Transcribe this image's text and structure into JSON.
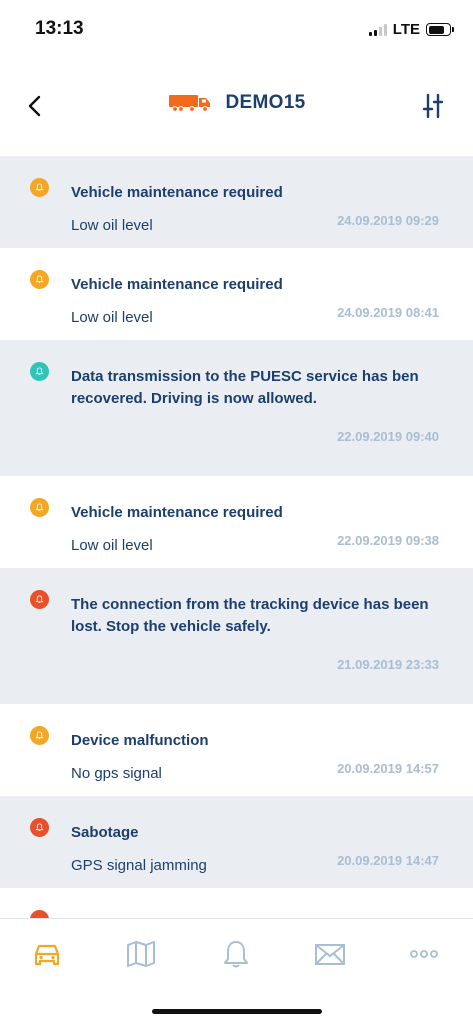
{
  "status": {
    "time": "13:13",
    "network": "LTE"
  },
  "header": {
    "title": "DEMO15"
  },
  "colors": {
    "accent_orange": "#f26b1d",
    "warning": "#f5a623",
    "info": "#2ec4b6",
    "alert": "#e8502a",
    "title_blue": "#1d3f6e",
    "date_gray": "#a9bdd3",
    "tab_inactive": "#a9bdd3"
  },
  "notifications": [
    {
      "severity": "warning",
      "icon": "bell-icon",
      "title": "Vehicle maintenance required",
      "subtitle": "Low oil level",
      "date": "24.09.2019 09:29"
    },
    {
      "severity": "warning",
      "icon": "bell-icon",
      "title": "Vehicle maintenance required",
      "subtitle": "Low oil level",
      "date": "24.09.2019 08:41"
    },
    {
      "severity": "info",
      "icon": "bell-icon",
      "title": "Data transmission to the PUESC service has ben recovered. Driving is now allowed.",
      "subtitle": "",
      "date": "22.09.2019 09:40"
    },
    {
      "severity": "warning",
      "icon": "bell-icon",
      "title": "Vehicle maintenance required",
      "subtitle": "Low oil level",
      "date": "22.09.2019 09:38"
    },
    {
      "severity": "alert",
      "icon": "bell-icon",
      "title": "The connection from the tracking device has been lost. Stop the vehicle safely.",
      "subtitle": "",
      "date": "21.09.2019 23:33"
    },
    {
      "severity": "warning",
      "icon": "bell-icon",
      "title": "Device malfunction",
      "subtitle": "No gps signal",
      "date": "20.09.2019 14:57"
    },
    {
      "severity": "alert",
      "icon": "bell-icon",
      "title": "Sabotage",
      "subtitle": "GPS signal jamming",
      "date": "20.09.2019 14:47"
    }
  ],
  "tabs": [
    {
      "icon": "car-icon",
      "active": true
    },
    {
      "icon": "map-icon",
      "active": false
    },
    {
      "icon": "bell-icon",
      "active": false
    },
    {
      "icon": "envelope-icon",
      "active": false
    },
    {
      "icon": "more-icon",
      "active": false
    }
  ]
}
